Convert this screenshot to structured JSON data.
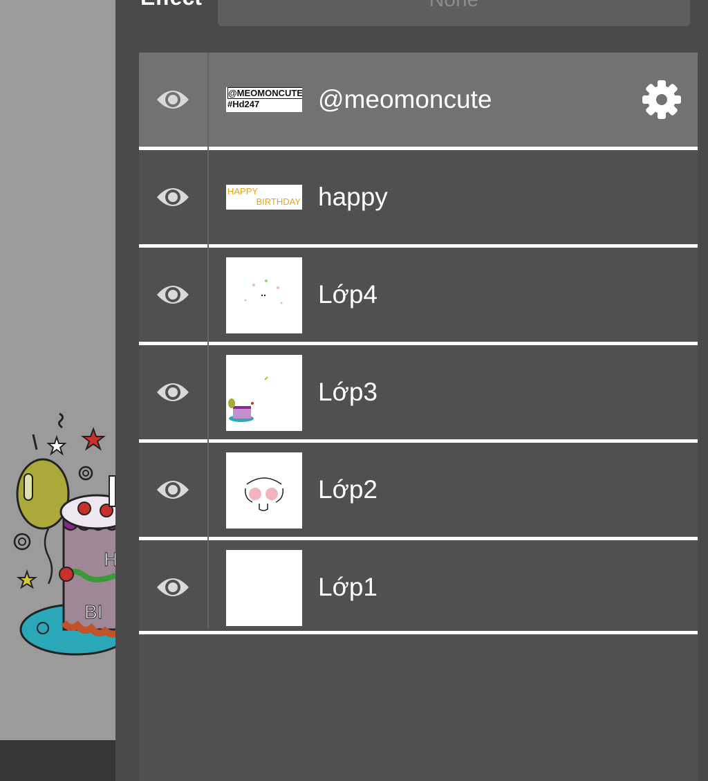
{
  "effect": {
    "label": "Effect",
    "value": "None"
  },
  "canvas": {
    "background": "#9b9b9b"
  },
  "layers": [
    {
      "name": "@meomoncute",
      "visible": true,
      "selected": true,
      "thumb_text": [
        "@MEOMONCUTE",
        "#Hd247"
      ],
      "settings_icon": "gear-icon"
    },
    {
      "name": "happy",
      "visible": true,
      "selected": false,
      "thumb_text": [
        "HAPPY",
        "BIRTHDAY"
      ]
    },
    {
      "name": "Lớp4",
      "visible": true,
      "selected": false
    },
    {
      "name": "Lớp3",
      "visible": true,
      "selected": false
    },
    {
      "name": "Lớp2",
      "visible": true,
      "selected": false
    },
    {
      "name": "Lớp1",
      "visible": true,
      "selected": false
    }
  ],
  "colors": {
    "panel": "#4a4a4a",
    "layer": "#505050",
    "selected_layer": "#727272",
    "separator": "#ffffff",
    "icon": "#d9d9d9"
  }
}
